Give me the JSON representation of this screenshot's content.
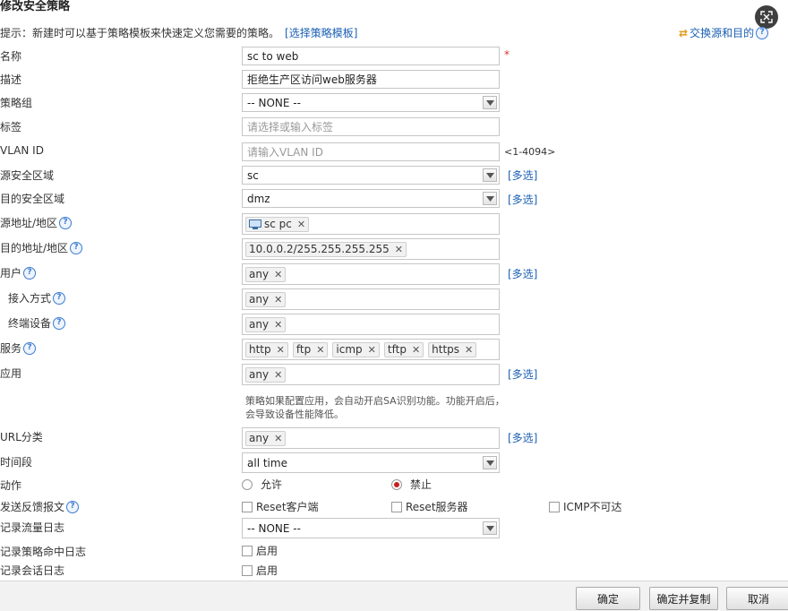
{
  "dialog": {
    "title": "修改安全策略"
  },
  "hint": {
    "text": "提示：新建时可以基于策略模板来快速定义您需要的策略。",
    "link": "[选择策略模板]"
  },
  "swap": {
    "label": "交换源和目的"
  },
  "fields": {
    "name": {
      "label": "名称",
      "value": "sc to web",
      "required_mark": "*"
    },
    "desc": {
      "label": "描述",
      "value": "拒绝生产区访问web服务器"
    },
    "group": {
      "label": "策略组",
      "value": "-- NONE --"
    },
    "tag": {
      "label": "标签",
      "placeholder": "请选择或输入标签"
    },
    "vlan": {
      "label": "VLAN ID",
      "placeholder": "请输入VLAN ID",
      "range": "<1-4094>"
    },
    "src_zone": {
      "label": "源安全区域",
      "value": "sc",
      "more": "[多选]"
    },
    "dst_zone": {
      "label": "目的安全区域",
      "value": "dmz",
      "more": "[多选]"
    },
    "src_addr": {
      "label": "源地址/地区",
      "tags": [
        "sc pc"
      ]
    },
    "dst_addr": {
      "label": "目的地址/地区",
      "tags": [
        "10.0.0.2/255.255.255.255"
      ]
    },
    "user": {
      "label": "用户",
      "tags": [
        "any"
      ],
      "more": "[多选]"
    },
    "access": {
      "label": "接入方式",
      "tags": [
        "any"
      ]
    },
    "device": {
      "label": "终端设备",
      "tags": [
        "any"
      ]
    },
    "service": {
      "label": "服务",
      "tags": [
        "http",
        "ftp",
        "icmp",
        "tftp",
        "https"
      ]
    },
    "app": {
      "label": "应用",
      "tags": [
        "any"
      ],
      "more": "[多选]",
      "note": "策略如果配置应用，会自动开启SA识别功能。功能开启后，会导致设备性能降低。"
    },
    "url": {
      "label": "URL分类",
      "tags": [
        "any"
      ],
      "more": "[多选]"
    },
    "time": {
      "label": "时间段",
      "value": "all time"
    },
    "action": {
      "label": "动作",
      "options": [
        "允许",
        "禁止"
      ],
      "selected": "禁止"
    },
    "feedback": {
      "label": "发送反馈报文",
      "options": [
        "Reset客户端",
        "Reset服务器",
        "ICMP不可达"
      ]
    },
    "traffic_log": {
      "label": "记录流量日志",
      "value": "-- NONE --"
    },
    "hit_log": {
      "label": "记录策略命中日志",
      "option": "启用"
    },
    "session_log": {
      "label": "记录会话日志",
      "option": "启用"
    }
  },
  "buttons": {
    "ok": "确定",
    "ok_copy": "确定并复制",
    "cancel": "取消"
  },
  "icons": {
    "corner": "resize-icon",
    "swap": "swap-arrows-icon",
    "help": "question-icon",
    "pc": "computer-icon"
  }
}
